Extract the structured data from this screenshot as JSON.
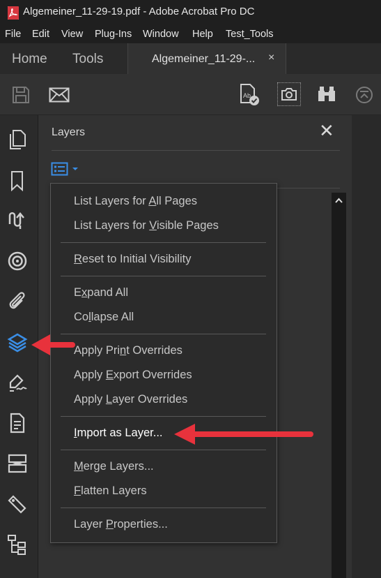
{
  "window": {
    "title": "Algemeiner_11-29-19.pdf - Adobe Acrobat Pro DC"
  },
  "menubar": {
    "items": [
      "File",
      "Edit",
      "View",
      "Plug-Ins",
      "Window",
      "Help",
      "Test_Tools"
    ]
  },
  "tabs": {
    "home": "Home",
    "tools": "Tools",
    "document": "Algemeiner_11-29-...",
    "close": "×"
  },
  "toolbar": {
    "icons": [
      "save-icon",
      "email-icon",
      "check-spelling-icon",
      "snapshot-icon",
      "find-binoculars-icon",
      "collapse-toolbar-icon"
    ]
  },
  "rail": {
    "icons": [
      "page-thumbnails-icon",
      "bookmarks-icon",
      "signatures-icon",
      "destinations-icon",
      "attachments-icon",
      "layers-icon",
      "fill-sign-icon",
      "document-icon",
      "compare-icon",
      "tags-icon",
      "content-tree-icon"
    ]
  },
  "panel": {
    "title": "Layers",
    "close": "✕",
    "options_icon": "options-menu-icon"
  },
  "menu": {
    "items": [
      {
        "pre": "List Layers for ",
        "key": "A",
        "post": "ll Pages"
      },
      {
        "pre": "List Layers for ",
        "key": "V",
        "post": "isible Pages"
      },
      {
        "pre": "",
        "key": "R",
        "post": "eset to Initial Visibility"
      },
      {
        "pre": "E",
        "key": "x",
        "post": "pand All"
      },
      {
        "pre": "Co",
        "key": "l",
        "post": "lapse All"
      },
      {
        "pre": "Apply Pri",
        "key": "n",
        "post": "t Overrides"
      },
      {
        "pre": "Apply ",
        "key": "E",
        "post": "xport Overrides"
      },
      {
        "pre": "Apply ",
        "key": "L",
        "post": "ayer Overrides"
      },
      {
        "pre": "",
        "key": "I",
        "post": "mport as Layer..."
      },
      {
        "pre": "",
        "key": "M",
        "post": "erge Layers..."
      },
      {
        "pre": "",
        "key": "F",
        "post": "latten Layers"
      },
      {
        "pre": "Layer ",
        "key": "P",
        "post": "roperties..."
      }
    ]
  },
  "colors": {
    "accent_blue": "#3a8ee6",
    "arrow_red": "#e8323c"
  }
}
